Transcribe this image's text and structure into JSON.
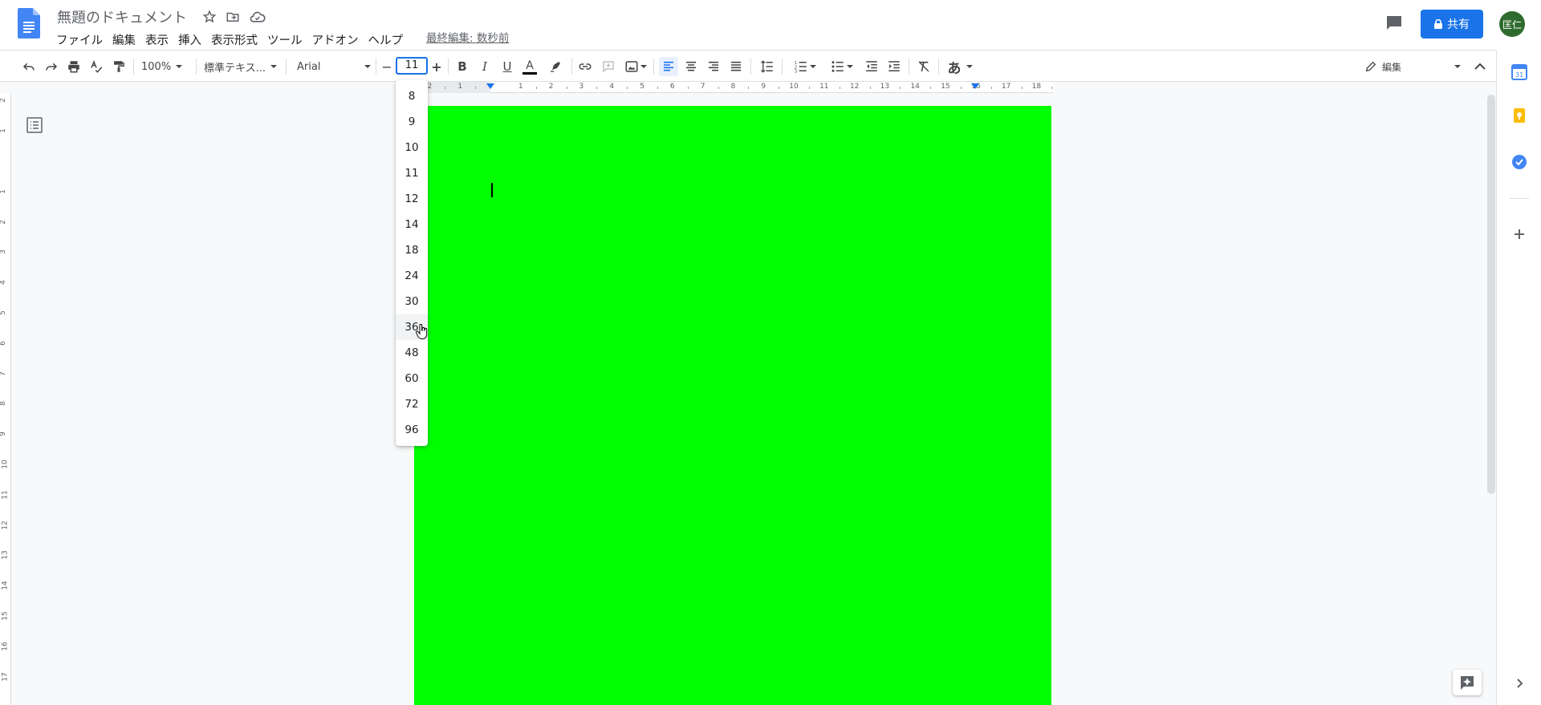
{
  "header": {
    "title": "無題のドキュメント",
    "menu": [
      "ファイル",
      "編集",
      "表示",
      "挿入",
      "表示形式",
      "ツール",
      "アドオン",
      "ヘルプ"
    ],
    "last_edit": "最終編集: 数秒前",
    "share_label": "共有",
    "avatar_text": "匡仁"
  },
  "toolbar": {
    "zoom": "100%",
    "style": "標準テキス...",
    "font": "Arial",
    "font_size": "11",
    "decrease": "−",
    "increase": "+",
    "bold": "B",
    "italic": "I",
    "underline": "U",
    "text_color": "A",
    "input_tools": "あ",
    "mode": "編集"
  },
  "font_size_dropdown": {
    "options": [
      "8",
      "9",
      "10",
      "11",
      "12",
      "14",
      "18",
      "24",
      "30",
      "36",
      "48",
      "60",
      "72",
      "96"
    ],
    "hovered": "36"
  },
  "ruler": {
    "labels": [
      "2",
      "1",
      "1",
      "2",
      "3",
      "4",
      "5",
      "6",
      "7",
      "8",
      "9",
      "10",
      "11",
      "12",
      "13",
      "14",
      "15",
      "16",
      "17",
      "18"
    ]
  },
  "vruler": {
    "labels": [
      "2",
      "1",
      "1",
      "2",
      "3",
      "4",
      "5",
      "6",
      "7",
      "8",
      "9",
      "10",
      "11",
      "12",
      "13",
      "14",
      "15",
      "16",
      "17"
    ]
  },
  "colors": {
    "page": "#00ff00",
    "accent": "#1a73e8",
    "avatar": "#2e6b2e"
  }
}
